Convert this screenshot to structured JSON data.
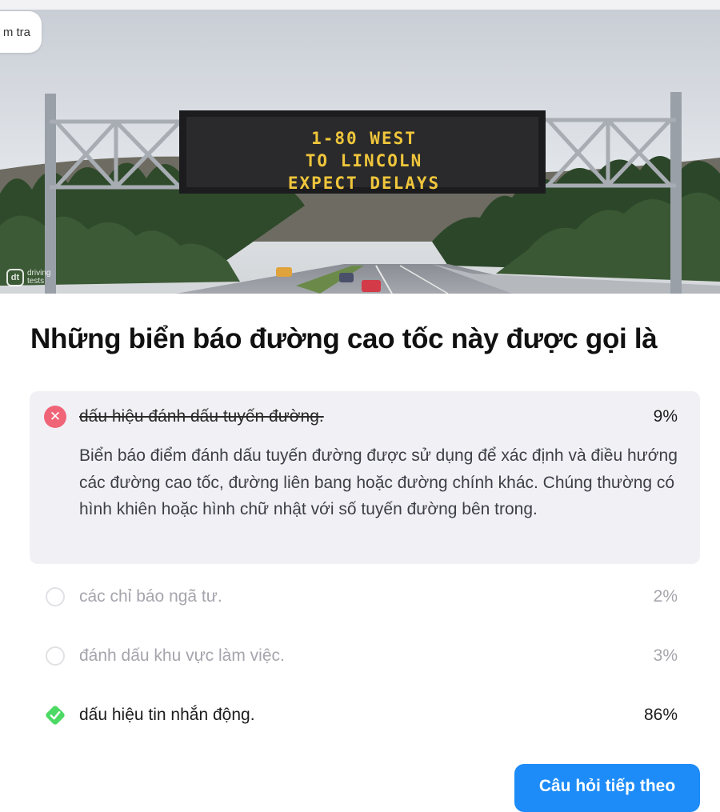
{
  "header": {
    "back_label": "m tra"
  },
  "image": {
    "sign_lines": [
      "1-80 WEST",
      "TO LINCOLN",
      "EXPECT DELAYS"
    ],
    "watermark": "driving tests"
  },
  "question": "Những biển báo đường cao tốc này được gọi là",
  "answers": [
    {
      "text": "dấu hiệu đánh dấu tuyến đường.",
      "percent": "9%",
      "state": "wrong-selected",
      "explanation": "Biển báo điểm đánh dấu tuyến đường được sử dụng để xác định và điều hướng các đường cao tốc, đường liên bang hoặc đường chính khác. Chúng thường có hình khiên hoặc hình chữ nhật với số tuyến đường bên trong."
    },
    {
      "text": "các chỉ báo ngã tư.",
      "percent": "2%",
      "state": "unselected"
    },
    {
      "text": "đánh dấu khu vực làm việc.",
      "percent": "3%",
      "state": "unselected"
    },
    {
      "text": "dấu hiệu tin nhắn động.",
      "percent": "86%",
      "state": "correct"
    }
  ],
  "next_button": "Câu hỏi tiếp theo",
  "colors": {
    "wrong": "#f06478",
    "correct": "#4cd964",
    "accent": "#1d8cf8"
  }
}
